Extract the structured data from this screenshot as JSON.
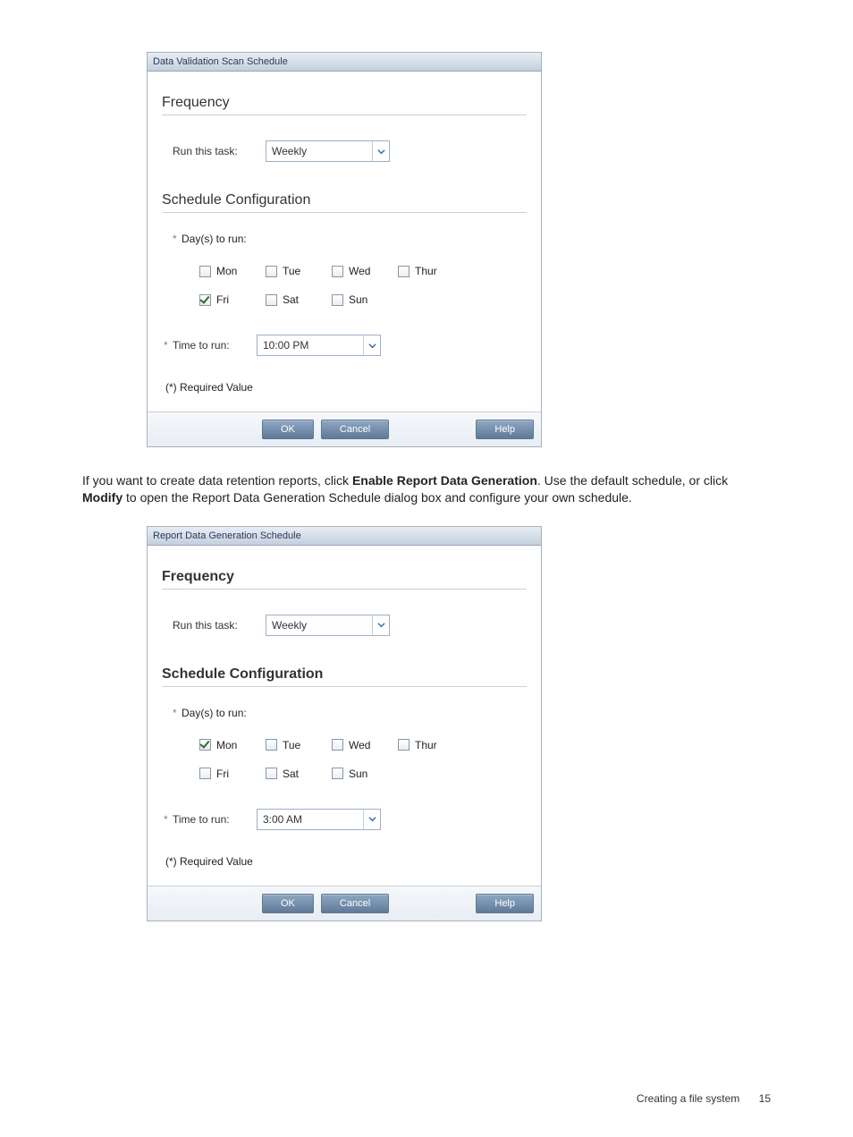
{
  "dialog1": {
    "title": "Data Validation Scan Schedule",
    "titleBold": false,
    "frequency": {
      "heading": "Frequency",
      "runLabel": "Run this task:",
      "runValue": "Weekly"
    },
    "schedule": {
      "heading": "Schedule Configuration",
      "daysLabel": "Day(s) to run:",
      "days": [
        {
          "label": "Mon",
          "checked": false
        },
        {
          "label": "Tue",
          "checked": false
        },
        {
          "label": "Wed",
          "checked": false
        },
        {
          "label": "Thur",
          "checked": false
        },
        {
          "label": "Fri",
          "checked": true
        },
        {
          "label": "Sat",
          "checked": false
        },
        {
          "label": "Sun",
          "checked": false
        }
      ],
      "timeLabel": "Time to run:",
      "timeValue": "10:00 PM"
    },
    "requiredNote": "(*) Required Value",
    "buttons": {
      "ok": "OK",
      "cancel": "Cancel",
      "help": "Help"
    }
  },
  "paragraph": {
    "t1": "If you want to create data retention reports, click ",
    "b1": "Enable Report Data Generation",
    "t2": ". Use the default schedule, or click ",
    "b2": "Modify",
    "t3": " to open the Report Data Generation Schedule dialog box and configure your own schedule."
  },
  "dialog2": {
    "title": "Report Data Generation Schedule",
    "titleBold": true,
    "frequency": {
      "heading": "Frequency",
      "runLabel": "Run this task:",
      "runValue": "Weekly"
    },
    "schedule": {
      "heading": "Schedule Configuration",
      "daysLabel": "Day(s) to run:",
      "days": [
        {
          "label": "Mon",
          "checked": true
        },
        {
          "label": "Tue",
          "checked": false
        },
        {
          "label": "Wed",
          "checked": false
        },
        {
          "label": "Thur",
          "checked": false
        },
        {
          "label": "Fri",
          "checked": false
        },
        {
          "label": "Sat",
          "checked": false
        },
        {
          "label": "Sun",
          "checked": false
        }
      ],
      "timeLabel": "Time to run:",
      "timeValue": "3:00 AM"
    },
    "requiredNote": "(*) Required Value",
    "buttons": {
      "ok": "OK",
      "cancel": "Cancel",
      "help": "Help"
    }
  },
  "footer": {
    "section": "Creating a file system",
    "page": "15"
  }
}
